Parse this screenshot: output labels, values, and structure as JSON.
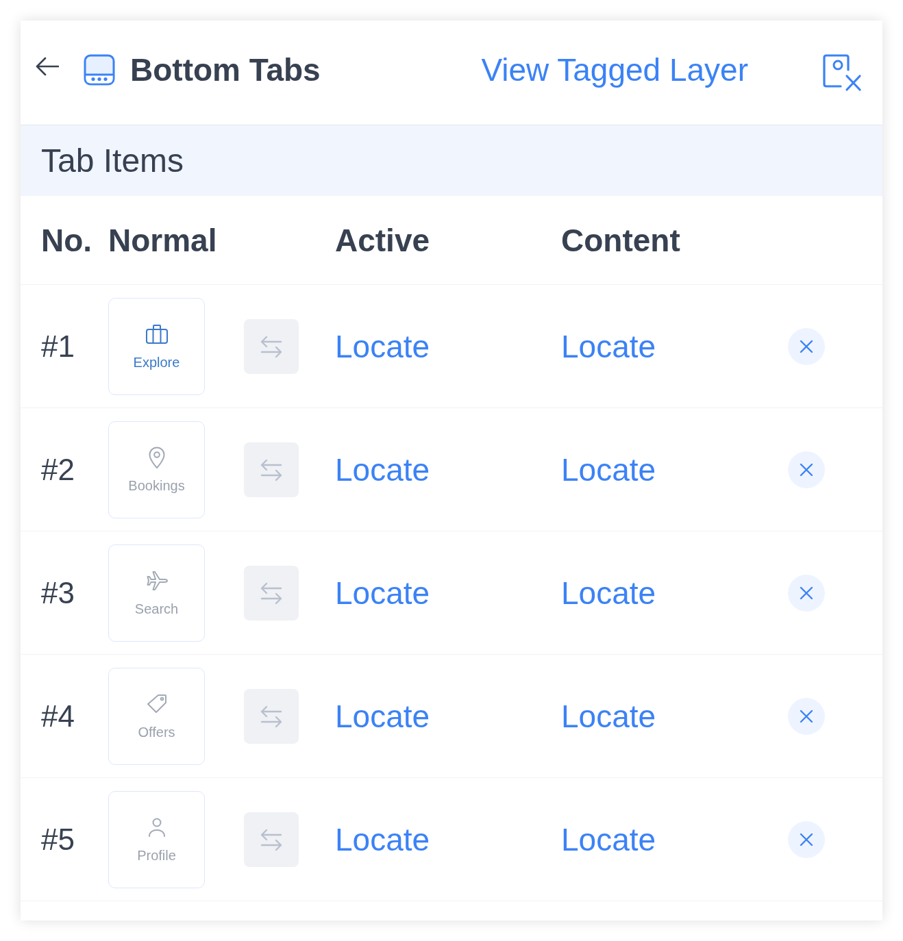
{
  "header": {
    "title": "Bottom Tabs",
    "link": "View Tagged Layer"
  },
  "section": {
    "title": "Tab Items"
  },
  "table": {
    "columns": [
      "No.",
      "Normal",
      "Active",
      "Content"
    ],
    "rows": [
      {
        "number": "#1",
        "tab_label": "Explore",
        "selected": true,
        "active": "Locate",
        "content": "Locate"
      },
      {
        "number": "#2",
        "tab_label": "Bookings",
        "selected": false,
        "active": "Locate",
        "content": "Locate"
      },
      {
        "number": "#3",
        "tab_label": "Search",
        "selected": false,
        "active": "Locate",
        "content": "Locate"
      },
      {
        "number": "#4",
        "tab_label": "Offers",
        "selected": false,
        "active": "Locate",
        "content": "Locate"
      },
      {
        "number": "#5",
        "tab_label": "Profile",
        "selected": false,
        "active": "Locate",
        "content": "Locate"
      }
    ]
  }
}
